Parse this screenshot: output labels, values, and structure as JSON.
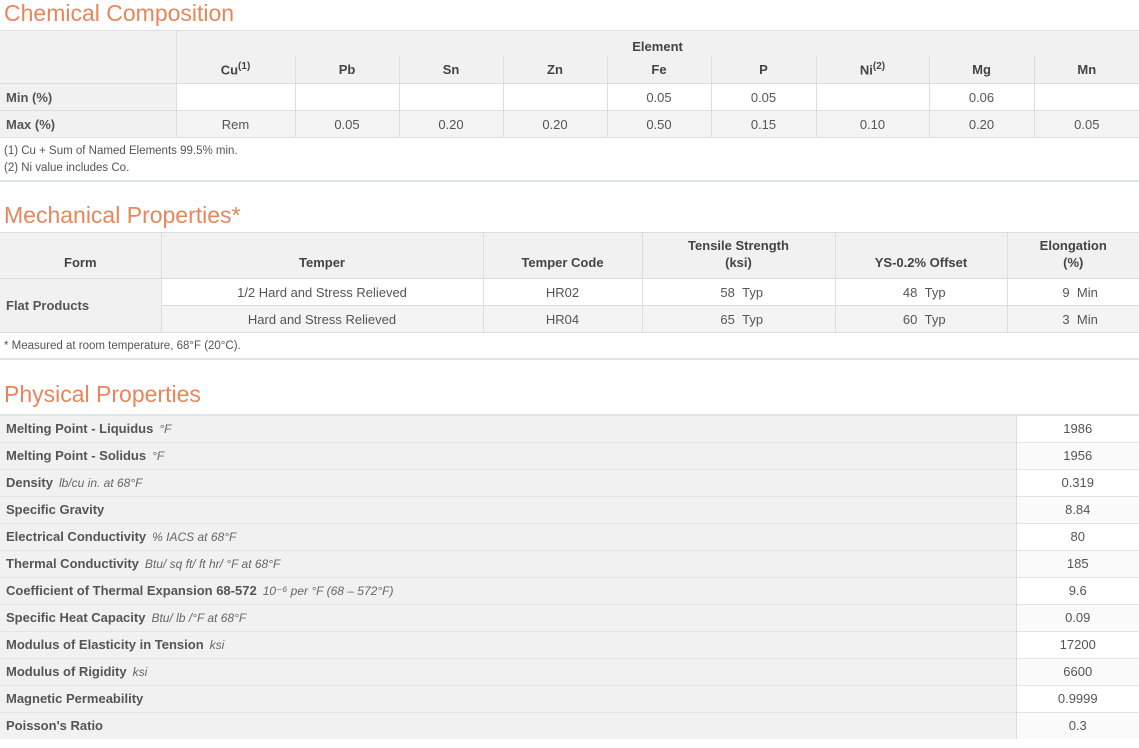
{
  "chem": {
    "title": "Chemical Composition",
    "group_header": "Element",
    "columns": [
      {
        "name": "Cu",
        "sup": "(1)"
      },
      {
        "name": "Pb",
        "sup": ""
      },
      {
        "name": "Sn",
        "sup": ""
      },
      {
        "name": "Zn",
        "sup": ""
      },
      {
        "name": "Fe",
        "sup": ""
      },
      {
        "name": "P",
        "sup": ""
      },
      {
        "name": "Ni",
        "sup": "(2)"
      },
      {
        "name": "Mg",
        "sup": ""
      },
      {
        "name": "Mn",
        "sup": ""
      }
    ],
    "rows": [
      {
        "label": "Min (%)",
        "values": [
          "",
          "",
          "",
          "",
          "0.05",
          "0.05",
          "",
          "0.06",
          ""
        ]
      },
      {
        "label": "Max (%)",
        "values": [
          "Rem",
          "0.05",
          "0.20",
          "0.20",
          "0.50",
          "0.15",
          "0.10",
          "0.20",
          "0.05"
        ]
      }
    ],
    "notes": [
      "(1) Cu + Sum of Named Elements 99.5% min.",
      "(2) Ni value includes Co."
    ]
  },
  "mech": {
    "title": "Mechanical Properties*",
    "headers": {
      "form": "Form",
      "temper": "Temper",
      "temper_code": "Temper Code",
      "tensile_1": "Tensile Strength",
      "tensile_2": "(ksi)",
      "ys": "YS-0.2% Offset",
      "elong_1": "Elongation",
      "elong_2": "(%)"
    },
    "form": "Flat Products",
    "rows": [
      {
        "temper": "1/2 Hard and Stress Relieved",
        "code": "HR02",
        "tensile": "58",
        "tensile_type": "Typ",
        "ys": "48",
        "ys_type": "Typ",
        "elong": "9",
        "elong_type": "Min"
      },
      {
        "temper": "Hard and Stress Relieved",
        "code": "HR04",
        "tensile": "65",
        "tensile_type": "Typ",
        "ys": "60",
        "ys_type": "Typ",
        "elong": "3",
        "elong_type": "Min"
      }
    ],
    "note": "* Measured at room temperature, 68°F (20°C)."
  },
  "phys": {
    "title": "Physical Properties",
    "rows": [
      {
        "label": "Melting Point - Liquidus",
        "unit": "°F",
        "value": "1986"
      },
      {
        "label": "Melting Point - Solidus",
        "unit": "°F",
        "value": "1956"
      },
      {
        "label": "Density",
        "unit": "lb/cu in. at 68°F",
        "value": "0.319"
      },
      {
        "label": "Specific Gravity",
        "unit": "",
        "value": "8.84"
      },
      {
        "label": "Electrical Conductivity",
        "unit": "% IACS at 68°F",
        "value": "80"
      },
      {
        "label": "Thermal Conductivity",
        "unit": "Btu/ sq ft/ ft hr/ °F at 68°F",
        "value": "185"
      },
      {
        "label": "Coefficient of Thermal Expansion 68-572",
        "unit": "10⁻⁶ per °F (68 – 572°F)",
        "value": "9.6"
      },
      {
        "label": "Specific Heat Capacity",
        "unit": "Btu/ lb /°F at 68°F",
        "value": "0.09"
      },
      {
        "label": "Modulus of Elasticity in Tension",
        "unit": "ksi",
        "value": "17200"
      },
      {
        "label": "Modulus of Rigidity",
        "unit": "ksi",
        "value": "6600"
      },
      {
        "label": "Magnetic Permeability",
        "unit": "",
        "value": "0.9999"
      },
      {
        "label": "Poisson's Ratio",
        "unit": "",
        "value": "0.3"
      }
    ]
  }
}
